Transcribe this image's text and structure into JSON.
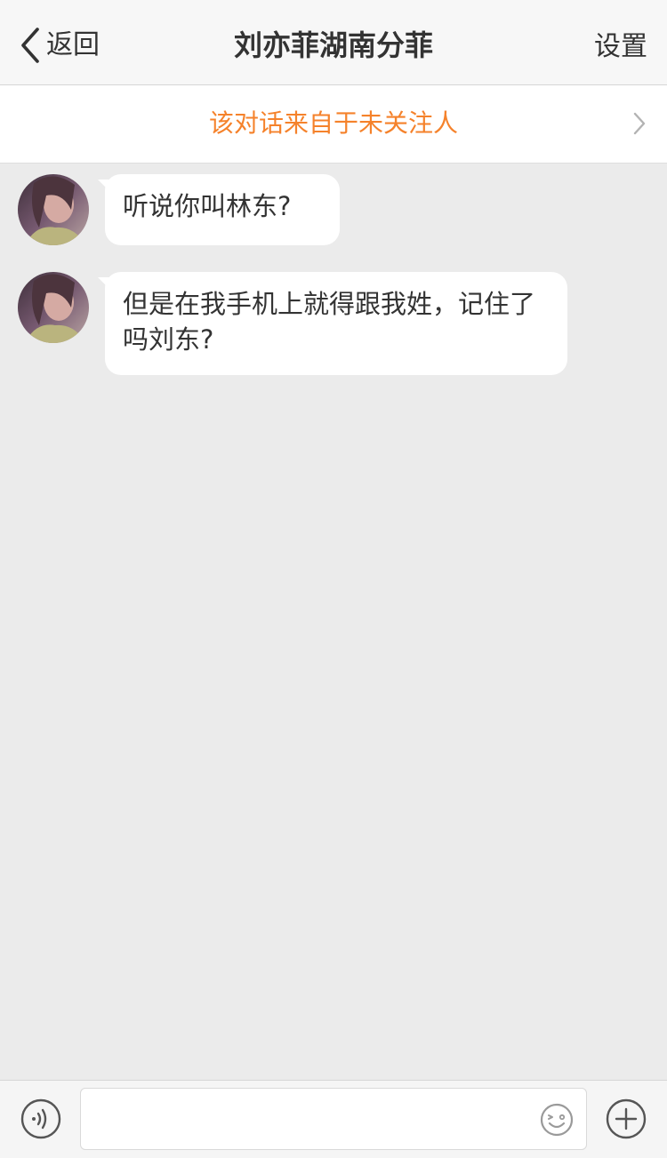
{
  "nav": {
    "back_label": "返回",
    "title": "刘亦菲湖南分菲",
    "settings_label": "设置"
  },
  "banner": {
    "text": "该对话来自于未关注人",
    "color": "#f5822b"
  },
  "messages": [
    {
      "text": "听说你叫林东?"
    },
    {
      "text": "但是在我手机上就得跟我姓，记住了吗刘东?"
    }
  ],
  "input": {
    "value": "",
    "placeholder": ""
  },
  "icons": {
    "back": "chevron-left-icon",
    "banner": "chevron-right-icon",
    "voice": "voice-icon",
    "emoji": "emoji-icon",
    "more": "plus-circle-icon"
  }
}
